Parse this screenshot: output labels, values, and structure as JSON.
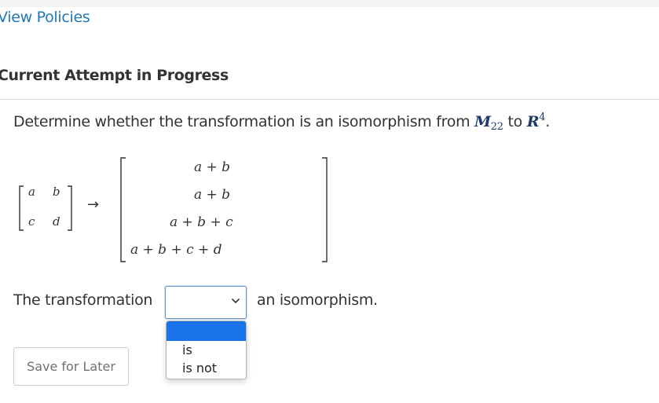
{
  "links": {
    "view_policies": "View Policies"
  },
  "heading": "Current Attempt in Progress",
  "question": {
    "text": "Determine whether the transformation is an isomorphism from",
    "space_from": "M",
    "space_from_sub": "22",
    "connector": "to",
    "space_to": "R",
    "space_to_sup": "4",
    "period": "."
  },
  "matrix": {
    "a": "a",
    "b": "b",
    "c": "c",
    "d": "d",
    "arrow": "→"
  },
  "vector": {
    "rows": [
      "a + b",
      "a + b",
      "a + b + c",
      "a + b + c + d"
    ]
  },
  "statement": {
    "before": "The transformation",
    "after": "an isomorphism."
  },
  "select": {
    "selected": "",
    "options": [
      "",
      "is",
      "is not"
    ]
  },
  "buttons": {
    "save_for_later": "Save for Later"
  },
  "colors": {
    "link": "#2277b8",
    "highlight": "#1a73e8",
    "select_border": "#6a95c7"
  },
  "icons": {
    "select": "chevron-down-icon"
  }
}
